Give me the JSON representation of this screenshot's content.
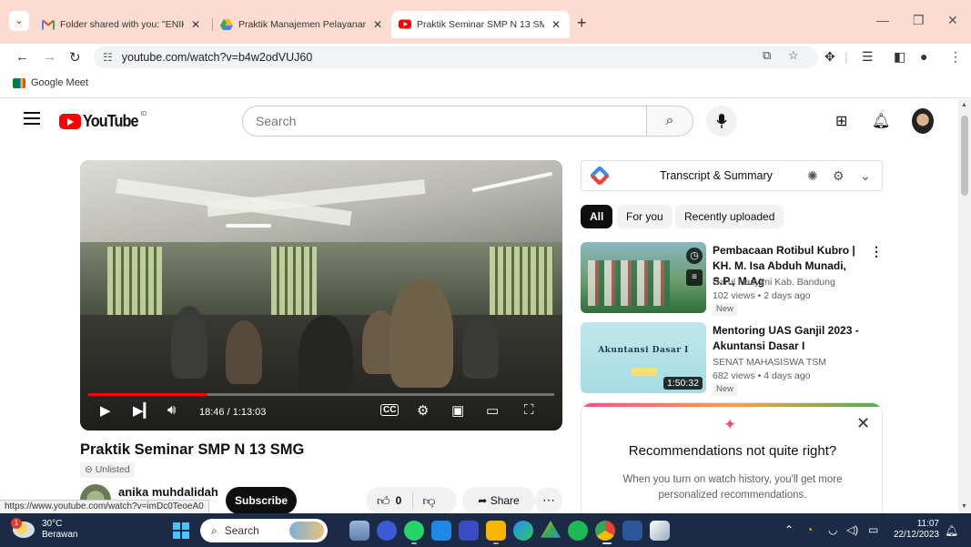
{
  "browser": {
    "tabs": [
      {
        "title": "Folder shared with you: \"ENIK N",
        "active": false
      },
      {
        "title": "Praktik Manajemen Pelayanan I",
        "active": false
      },
      {
        "title": "Praktik Seminar SMP N 13 SMG",
        "active": true
      }
    ],
    "new_tab": "+",
    "url": "youtube.com/watch?v=b4w2odVUJ60",
    "bookmark": "Google Meet"
  },
  "youtube": {
    "logo_text": "YouTube",
    "logo_country": "ID",
    "search_placeholder": "Search"
  },
  "video": {
    "title": "Praktik Seminar SMP N 13 SMG",
    "visibility": "Unlisted",
    "time": "18:46 / 1:13:03",
    "progress_fraction": 0.256,
    "channel_name": "anika muhdalidah",
    "subscribe_label": "Subscribe",
    "likes": "0",
    "share_label": "Share"
  },
  "status_url": "https://www.youtube.com/watch?v=imDc0TeoeA0",
  "sidebar": {
    "extension_title": "Transcript & Summary",
    "chips": [
      {
        "label": "All",
        "selected": true
      },
      {
        "label": "For you",
        "selected": false
      },
      {
        "label": "Recently uploaded",
        "selected": false
      }
    ],
    "recommendations": [
      {
        "title": "Pembacaan Rotibul Kubro | KH. M. Isa Abduh Munadi, S.P., M.Ag",
        "channel": "Darul Hasyimi Kab. Bandung",
        "meta": "102 views • 2 days ago",
        "badge": "New",
        "duration": ""
      },
      {
        "title": "Mentoring UAS Ganjil 2023 - Akuntansi Dasar I",
        "channel": "SENAT MAHASISWA TSM",
        "meta": "682 views • 4 days ago",
        "badge": "New",
        "duration": "1:50:32",
        "thumb_text": "Akuntansi Dasar I"
      }
    ],
    "notice": {
      "heading": "Recommendations not quite right?",
      "body": "When you turn on watch history, you'll get more personalized recommendations."
    }
  },
  "taskbar": {
    "temperature": "30°C",
    "weather": "Berawan",
    "weather_badge": "1",
    "search_label": "Search",
    "time": "11:07",
    "date": "22/12/2023"
  },
  "colors": {
    "tabbar": "#fcdcd0",
    "youtube_red": "#ff0000",
    "taskbar": "#1b2b45"
  }
}
